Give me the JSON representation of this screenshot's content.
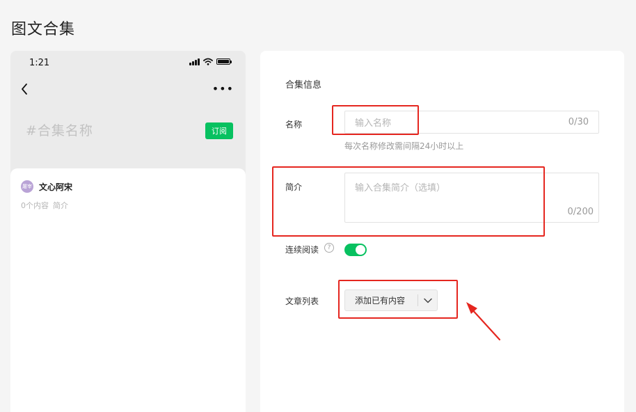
{
  "page": {
    "title": "图文合集"
  },
  "preview": {
    "time": "1:21",
    "collection_name": "#合集名称",
    "subscribe_label": "订阅",
    "avatar_text": "屠宰",
    "author_name": "文心阿宋",
    "meta": [
      "0个内容",
      "简介"
    ]
  },
  "form": {
    "section_title": "合集信息",
    "name": {
      "label": "名称",
      "placeholder": "输入名称",
      "counter": "0/30",
      "hint": "每次名称修改需间隔24小时以上"
    },
    "intro": {
      "label": "简介",
      "placeholder": "输入合集简介（选填）",
      "counter": "0/200"
    },
    "continuous": {
      "label": "连续阅读",
      "help": "?",
      "enabled": true
    },
    "articles": {
      "label": "文章列表",
      "button": "添加已有内容"
    }
  },
  "colors": {
    "accent": "#07c160",
    "annotation": "#e5261f",
    "background": "#f5f5f5"
  }
}
